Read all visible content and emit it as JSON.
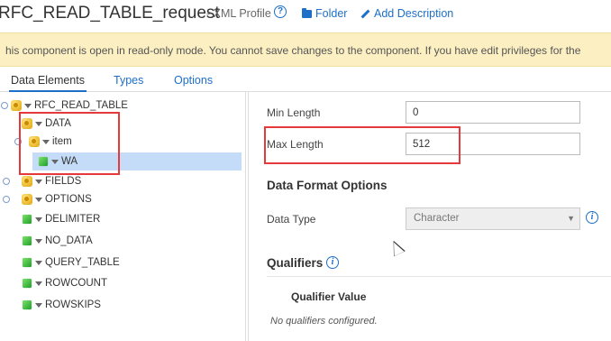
{
  "header": {
    "title": "RFC_READ_TABLE_request",
    "subtitle": "- XML Profile",
    "help_icon": "?",
    "folder_label": "Folder",
    "description_label": "Add Description"
  },
  "banner": {
    "text": "his component is open in read-only mode. You cannot save changes to the component. If you have edit privileges for the"
  },
  "tabs": {
    "data_elements": "Data Elements",
    "types": "Types",
    "options": "Options"
  },
  "tree": {
    "root": "RFC_READ_TABLE",
    "data": "DATA",
    "item": "item",
    "wa": "WA",
    "fields": "FIELDS",
    "options": "OPTIONS",
    "delimiter": "DELIMITER",
    "no_data": "NO_DATA",
    "query_table": "QUERY_TABLE",
    "rowcount": "ROWCOUNT",
    "rowskips": "ROWSKIPS"
  },
  "detail": {
    "min_length_label": "Min Length",
    "min_length_value": "0",
    "max_length_label": "Max Length",
    "max_length_value": "512",
    "data_format_heading": "Data Format Options",
    "data_type_label": "Data Type",
    "data_type_value": "Character",
    "data_type_arrow": "▼",
    "info_icon": "i",
    "qualifiers_heading": "Qualifiers",
    "qualifier_value_header": "Qualifier Value",
    "no_qualifiers": "No qualifiers configured."
  },
  "colors": {
    "accent": "#1e6fc7",
    "banner_bg": "#fcefc2",
    "selected_row": "#c4dcf7",
    "highlight": "#e5393c"
  }
}
